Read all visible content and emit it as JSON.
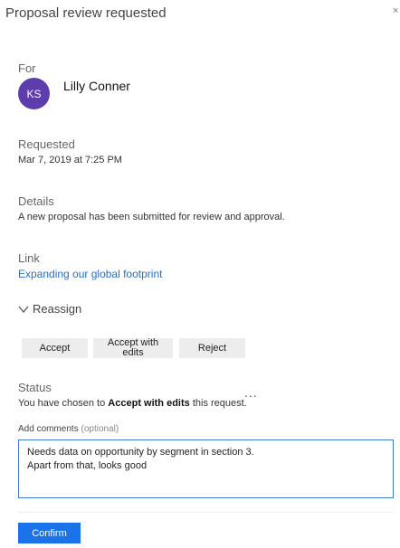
{
  "header": {
    "title": "Proposal review requested",
    "close_glyph": "×"
  },
  "for": {
    "label": "For",
    "initials": "KS",
    "name": "Lilly Conner",
    "avatar_color": "#5c3dab"
  },
  "requested": {
    "label": "Requested",
    "value": "Mar 7, 2019 at 7:25 PM"
  },
  "details": {
    "label": "Details",
    "value": "A new proposal has been submitted for review and approval."
  },
  "link": {
    "label": "Link",
    "text": "Expanding our global footprint",
    "color": "#2a6fc9"
  },
  "reassign": {
    "label": "Reassign"
  },
  "actions": {
    "accept": "Accept",
    "accept_with_edits_line1": "Accept with",
    "accept_with_edits_line2": "edits",
    "reject": "Reject"
  },
  "status": {
    "label": "Status",
    "prefix": "You have chosen to ",
    "choice": "Accept with edits",
    "suffix": " this request.",
    "more_glyph": "..."
  },
  "comments": {
    "label": "Add comments",
    "optional": "(optional)",
    "value": "Needs data on opportunity by segment in section 3.\nApart from that, looks good"
  },
  "confirm": {
    "label": "Confirm",
    "color": "#1a73e8"
  }
}
